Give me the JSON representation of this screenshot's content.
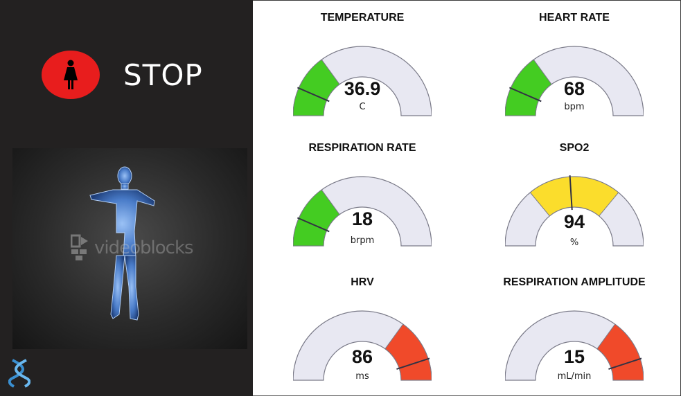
{
  "status": {
    "label": "STOP",
    "color": "#e81d1d",
    "icon": "female-person-icon"
  },
  "image": {
    "watermark": "videoblocks"
  },
  "gauges": [
    {
      "title": "TEMPERATURE",
      "value": "36.9",
      "unit": "C",
      "band": "green",
      "band_color": "#44cc22",
      "band_start": 0.0,
      "band_end": 0.3,
      "needle": 0.13
    },
    {
      "title": "HEART RATE",
      "value": "68",
      "unit": "bpm",
      "band": "green",
      "band_color": "#44cc22",
      "band_start": 0.0,
      "band_end": 0.3,
      "needle": 0.13
    },
    {
      "title": "RESPIRATION RATE",
      "value": "18",
      "unit": "brpm",
      "band": "green",
      "band_color": "#44cc22",
      "band_start": 0.0,
      "band_end": 0.3,
      "needle": 0.13
    },
    {
      "title": "SPO2",
      "value": "94",
      "unit": "%",
      "band": "yellow",
      "band_color": "#fbdd2c",
      "band_start": 0.28,
      "band_end": 0.72,
      "needle": 0.48
    },
    {
      "title": "HRV",
      "value": "86",
      "unit": "ms",
      "band": "red",
      "band_color": "#f04a2a",
      "band_start": 0.7,
      "band_end": 1.0,
      "needle": 0.9
    },
    {
      "title": "RESPIRATION AMPLITUDE",
      "value": "15",
      "unit": "mL/min",
      "band": "red",
      "band_color": "#f04a2a",
      "band_start": 0.7,
      "band_end": 1.0,
      "needle": 0.9
    }
  ],
  "colors": {
    "track": "#e8e8f2",
    "track_stroke": "#7a7a88",
    "needle": "#333344"
  }
}
